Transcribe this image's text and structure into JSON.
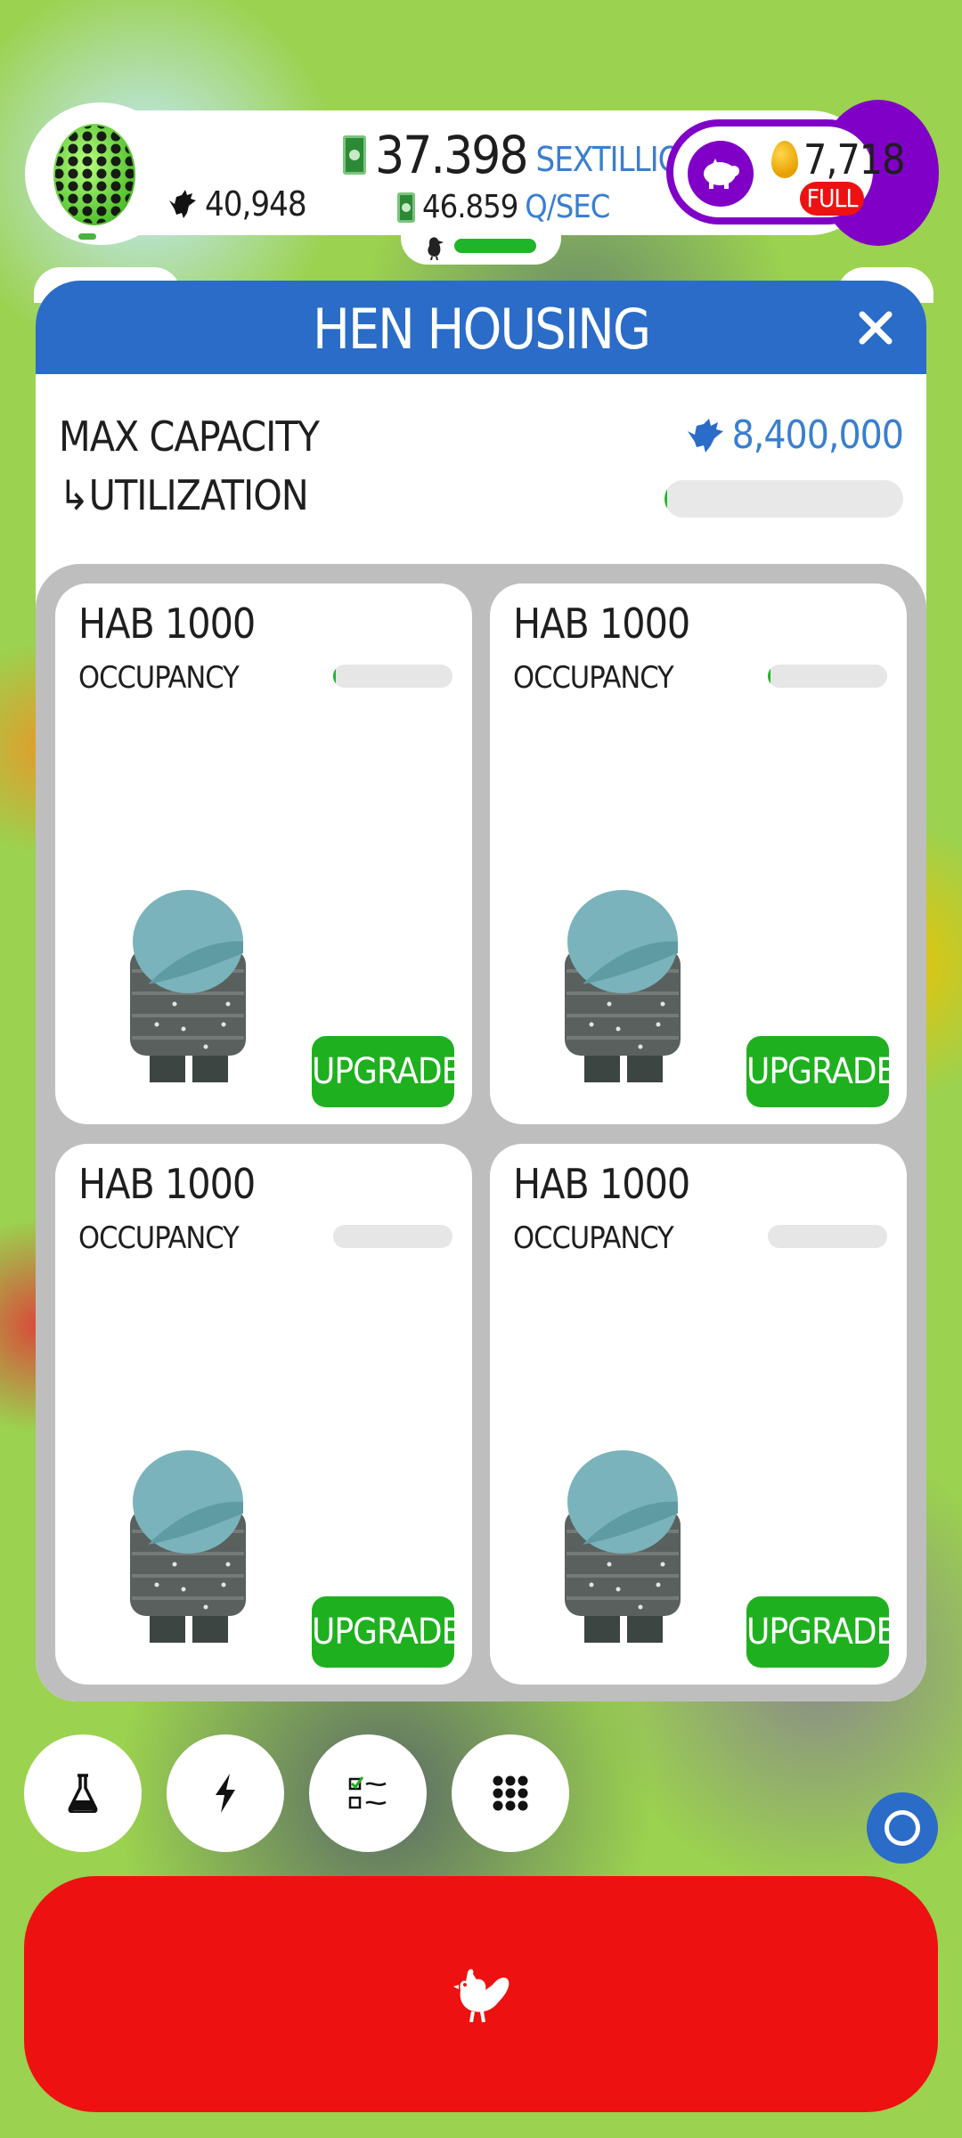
{
  "hud": {
    "egg_icon": "honeycomb-egg-icon",
    "chicken_count": "40,948",
    "cash_amount": "37.398",
    "cash_unit": "SEXTILLION",
    "rate_amount": "46.859",
    "rate_unit": "Q/SEC",
    "golden_eggs": "7,718",
    "bank_status": "FULL"
  },
  "dialog": {
    "title": "HEN HOUSING",
    "max_capacity_label": "MAX CAPACITY",
    "max_capacity_value": "8,400,000",
    "utilization_label": "↳UTILIZATION",
    "utilization_fraction": 0.0
  },
  "habs": [
    {
      "name": "HAB 1000",
      "occupancy_label": "OCCUPANCY",
      "occupancy_fraction": 0.01,
      "upgrade_label": "UPGRADE"
    },
    {
      "name": "HAB 1000",
      "occupancy_label": "OCCUPANCY",
      "occupancy_fraction": 0.01,
      "upgrade_label": "UPGRADE"
    },
    {
      "name": "HAB 1000",
      "occupancy_label": "OCCUPANCY",
      "occupancy_fraction": 0.0,
      "upgrade_label": "UPGRADE"
    },
    {
      "name": "HAB 1000",
      "occupancy_label": "OCCUPANCY",
      "occupancy_fraction": 0.0,
      "upgrade_label": "UPGRADE"
    }
  ],
  "toolbar": {
    "buttons": [
      "research-flask-icon",
      "boost-lightning-icon",
      "missions-checklist-icon",
      "menu-grid-icon"
    ],
    "hatch_icon": "chicken-icon"
  },
  "colors": {
    "header_blue": "#2a6cc8",
    "upgrade_green": "#1fb01f",
    "hatch_red": "#ee1111",
    "bank_purple": "#8000c8"
  }
}
